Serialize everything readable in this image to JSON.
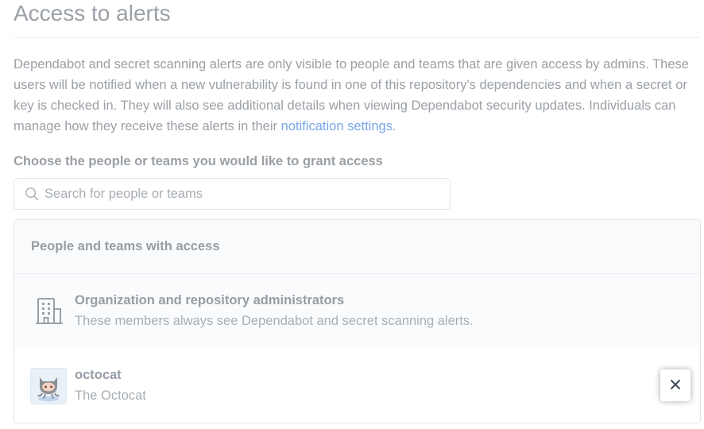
{
  "heading": "Access to alerts",
  "description": {
    "text": "Dependabot and secret scanning alerts are only visible to people and teams that are given access by admins. These users will be notified when a new vulnerability is found in one of this repository's dependencies and when a secret or key is checked in. They will also see additional details when viewing Dependabot security updates. Individuals can manage how they receive these alerts in their ",
    "link_text": "notification settings",
    "suffix": "."
  },
  "grant": {
    "label": "Choose the people or teams you would like to grant access",
    "search_placeholder": "Search for people or teams",
    "search_icon": "search-icon"
  },
  "access_list": {
    "header": "People and teams with access",
    "admins": {
      "icon": "organization-icon",
      "title": "Organization and repository administrators",
      "subtitle": "These members always see Dependabot and secret scanning alerts."
    },
    "users": [
      {
        "avatar": "octocat-avatar",
        "login": "octocat",
        "name": "The Octocat",
        "remove_icon": "close-icon"
      }
    ]
  },
  "colors": {
    "link": "#79a6e8",
    "muted_text": "#959da5",
    "border": "#e1e4e8",
    "row_bg": "#fafbfc"
  }
}
